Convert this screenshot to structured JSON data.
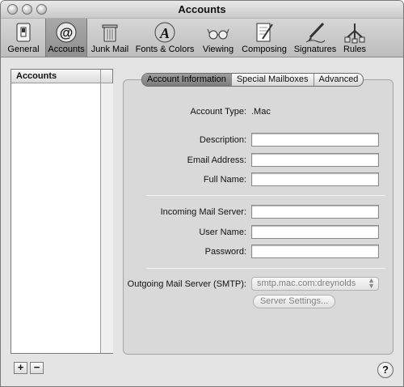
{
  "window": {
    "title": "Accounts"
  },
  "toolbar": {
    "items": [
      {
        "label": "General",
        "icon": "switch-icon"
      },
      {
        "label": "Accounts",
        "icon": "at-sign-icon"
      },
      {
        "label": "Junk Mail",
        "icon": "trash-can-icon"
      },
      {
        "label": "Fonts & Colors",
        "icon": "font-icon"
      },
      {
        "label": "Viewing",
        "icon": "glasses-icon"
      },
      {
        "label": "Composing",
        "icon": "pencil-paper-icon"
      },
      {
        "label": "Signatures",
        "icon": "pen-icon"
      },
      {
        "label": "Rules",
        "icon": "rules-icon"
      }
    ],
    "active": "Accounts"
  },
  "accounts_list": {
    "header": "Accounts",
    "add_label": "+",
    "remove_label": "−"
  },
  "tabs": [
    {
      "label": "Account Information",
      "active": true
    },
    {
      "label": "Special Mailboxes",
      "active": false
    },
    {
      "label": "Advanced",
      "active": false
    }
  ],
  "form": {
    "account_type_label": "Account Type:",
    "account_type_value": ".Mac",
    "description_label": "Description:",
    "description_value": "",
    "email_label": "Email Address:",
    "email_value": "",
    "fullname_label": "Full Name:",
    "fullname_value": "",
    "incoming_label": "Incoming Mail Server:",
    "incoming_value": "",
    "username_label": "User Name:",
    "username_value": "",
    "password_label": "Password:",
    "password_value": "",
    "outgoing_label": "Outgoing Mail Server (SMTP):",
    "outgoing_value": "smtp.mac.com:dreynolds",
    "server_settings_label": "Server Settings..."
  },
  "help": {
    "label": "?"
  }
}
